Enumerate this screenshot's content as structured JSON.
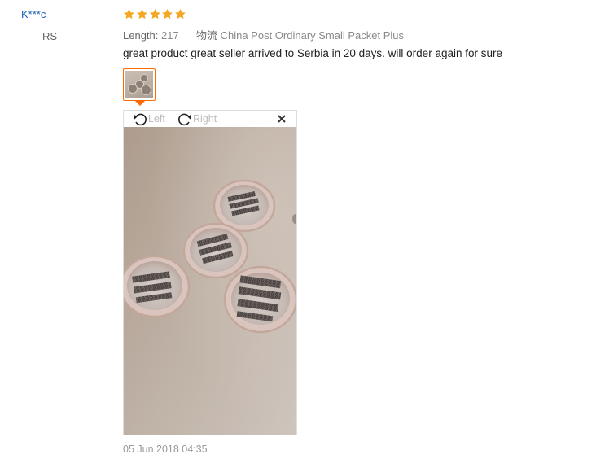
{
  "review": {
    "user_name": "K***c",
    "country": "RS",
    "rating": 5,
    "rating_color": "#f5a623",
    "length_label": "Length:",
    "length_value": "217",
    "shipping_label": "物流",
    "shipping_value": "China Post Ordinary Small Packet Plus",
    "text": "great product great seller arrived to Serbia in 20 days. will order again for sure",
    "date": "05 Jun 2018 04:35"
  },
  "viewer": {
    "rotate_left_label": "Left",
    "rotate_right_label": "Right",
    "close_icon": "close-icon",
    "accent_color": "#ff6a00"
  }
}
